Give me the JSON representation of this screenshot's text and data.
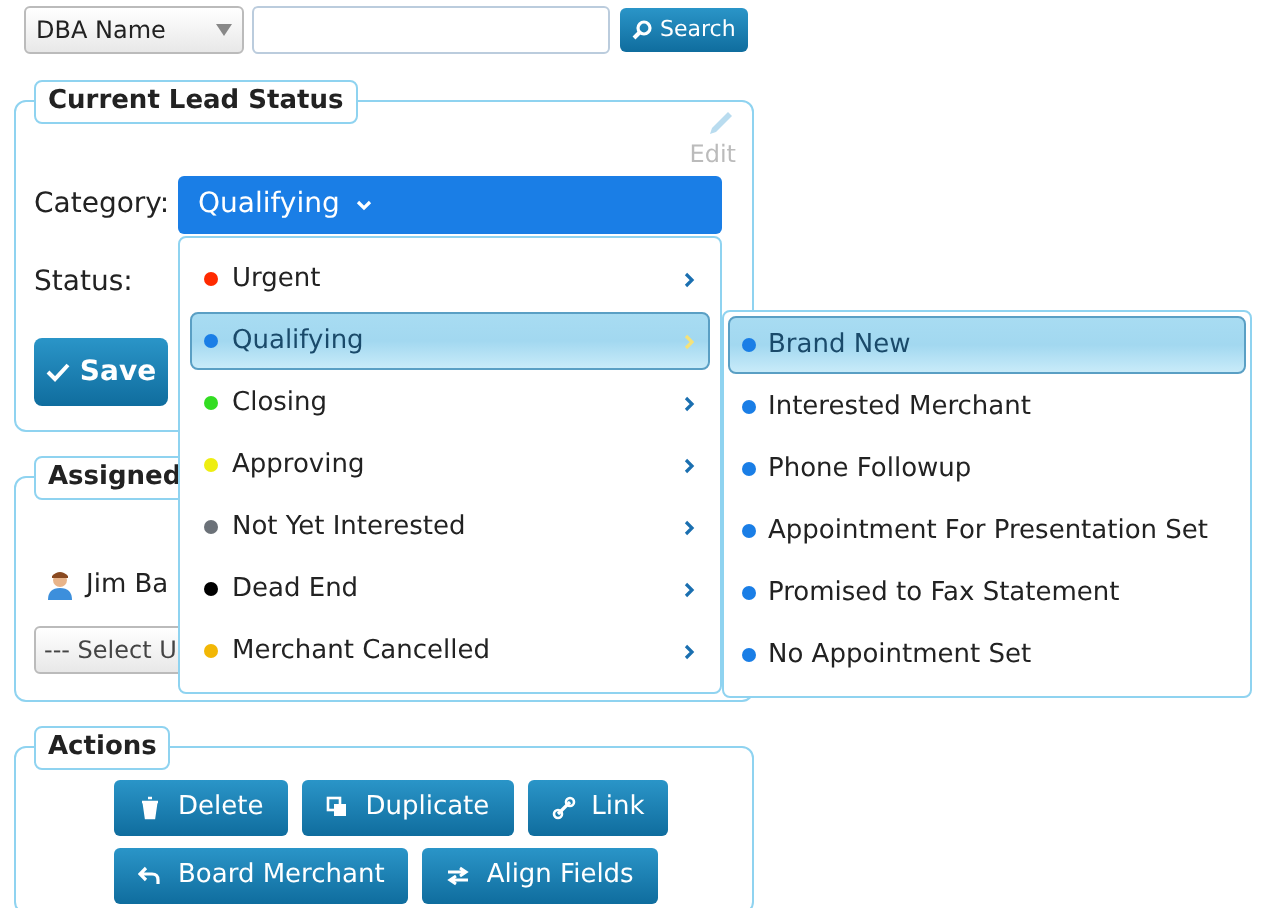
{
  "search_bar": {
    "field_select": "DBA Name",
    "button": "Search"
  },
  "lead_status": {
    "legend": "Current Lead Status",
    "edit": "Edit",
    "category_label": "Category:",
    "category_value": "Qualifying",
    "status_label": "Status:",
    "save": "Save"
  },
  "assigned": {
    "legend": "Assigned",
    "user": "Jim Ba",
    "user_select": "--- Select U"
  },
  "actions": {
    "legend": "Actions",
    "buttons": [
      {
        "label": "Delete"
      },
      {
        "label": "Duplicate"
      },
      {
        "label": "Link"
      },
      {
        "label": "Board Merchant"
      },
      {
        "label": "Align Fields"
      }
    ]
  },
  "category_menu": {
    "items": [
      {
        "label": "Urgent",
        "color": "#ff2a00",
        "selected": false
      },
      {
        "label": "Qualifying",
        "color": "#1a7ee6",
        "selected": true
      },
      {
        "label": "Closing",
        "color": "#33dd22",
        "selected": false
      },
      {
        "label": "Approving",
        "color": "#eeee11",
        "selected": false
      },
      {
        "label": "Not Yet Interested",
        "color": "#6b7178",
        "selected": false
      },
      {
        "label": "Dead End",
        "color": "#000000",
        "selected": false
      },
      {
        "label": "Merchant Cancelled",
        "color": "#f2b705",
        "selected": false
      }
    ]
  },
  "status_menu": {
    "items": [
      {
        "label": "Brand New",
        "selected": true
      },
      {
        "label": "Interested Merchant",
        "selected": false
      },
      {
        "label": "Phone Followup",
        "selected": false
      },
      {
        "label": "Appointment For Presentation Set",
        "selected": false
      },
      {
        "label": "Promised to Fax Statement",
        "selected": false
      },
      {
        "label": "No Appointment Set",
        "selected": false
      }
    ]
  }
}
